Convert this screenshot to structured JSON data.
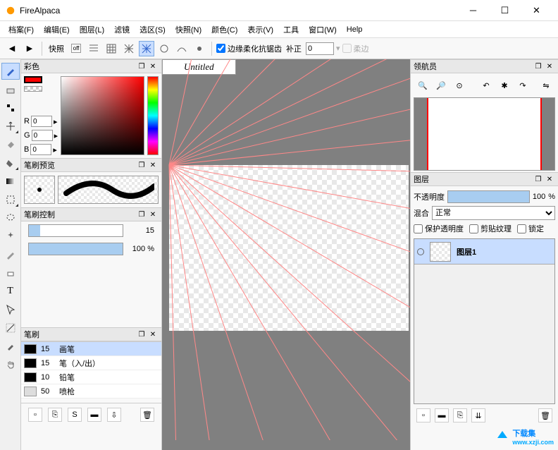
{
  "app": {
    "title": "FireAlpaca"
  },
  "menu": [
    "档案(F)",
    "编辑(E)",
    "图层(L)",
    "滤镜",
    "选区(S)",
    "快照(N)",
    "颜色(C)",
    "表示(V)",
    "工具",
    "窗口(W)",
    "Help"
  ],
  "toolbar": {
    "snap_label": "快照",
    "off_label": "off",
    "antialias_label": "边缘柔化抗锯齿",
    "correction_label": "补正",
    "correction_value": "0",
    "soft_label": "柔边"
  },
  "tab_title": "Untitled",
  "panels": {
    "color": {
      "title": "彩色",
      "r_label": "R",
      "g_label": "G",
      "b_label": "B",
      "r": "0",
      "g": "0",
      "b": "0"
    },
    "brush_preview": {
      "title": "笔刷预览"
    },
    "brush_control": {
      "title": "笔刷控制",
      "size_value": "15",
      "opacity_value": "100",
      "pct": "%"
    },
    "brush": {
      "title": "笔刷"
    },
    "navigator": {
      "title": "领航员"
    },
    "layers": {
      "title": "图层",
      "opacity_label": "不透明度",
      "opacity_value": "100",
      "pct": "%",
      "blend_label": "混合",
      "blend_value": "正常",
      "protect_label": "保护透明度",
      "clip_label": "剪贴纹理",
      "lock_label": "锁定",
      "layer_name": "图层1"
    }
  },
  "brushes": [
    {
      "size": "15",
      "name": "画笔",
      "sel": true,
      "light": false
    },
    {
      "size": "15",
      "name": "笔（入/出）",
      "sel": false,
      "light": false
    },
    {
      "size": "10",
      "name": "铅笔",
      "sel": false,
      "light": false
    },
    {
      "size": "50",
      "name": "喷枪",
      "sel": false,
      "light": true
    }
  ],
  "watermark": {
    "text": "下载集",
    "url": "www.xzji.com"
  }
}
